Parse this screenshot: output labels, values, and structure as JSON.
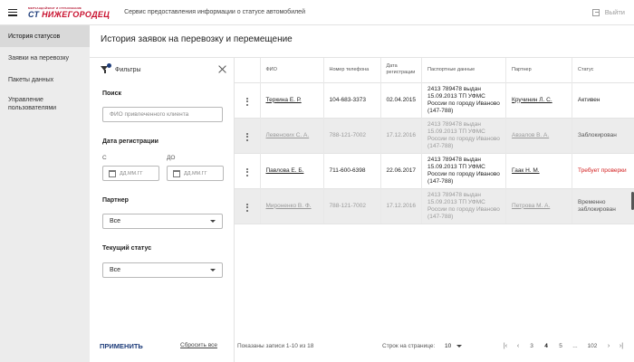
{
  "header": {
    "logo_top": "МЕРЧАНДАЙЗИНГ И СТРАХОВАНИЕ",
    "logo_main_prefix": "СТ",
    "logo_main": "НИЖЕГОРОДЕЦ",
    "subtitle": "Сервис предоставления информации о статусе автомобилей",
    "exit_label": "Выйти"
  },
  "sidebar": {
    "items": [
      {
        "label": "История статусов",
        "active": true
      },
      {
        "label": "Заявки на перевозку",
        "active": false
      },
      {
        "label": "Пакеты данных",
        "active": false
      },
      {
        "label": "Управление пользователями",
        "active": false
      }
    ]
  },
  "page": {
    "title": "История заявок на перевозку и перемещение"
  },
  "filters": {
    "title": "Фильтры",
    "search_label": "Поиск",
    "search_placeholder": "ФИО привлеченного клиента",
    "date_label": "Дата регистрации",
    "from_label": "С",
    "to_label": "ДО",
    "date_placeholder": "ДД.ММ.ГГ",
    "partner_label": "Партнер",
    "partner_value": "Все",
    "status_label": "Текущий статус",
    "status_value": "Все",
    "apply_label": "ПРИМЕНИТЬ",
    "reset_label": "Сбросить все"
  },
  "table": {
    "columns": [
      "ФИО",
      "Номер телефона",
      "Дата регистрации",
      "Паспортные данные",
      "Партнер",
      "Статус"
    ],
    "rows": [
      {
        "name": "Теркина Е. Р.",
        "phone": "104-683-3373",
        "date": "02.04.2015",
        "passport": "2413 789478 выдан 15.09.2013 ТП УФМС России по городу Иваново (147-788)",
        "partner": "Кручинин Л. С.",
        "status": "Активен"
      },
      {
        "name": "Левенских С. А.",
        "phone": "788-121-7002",
        "date": "17.12.2016",
        "passport": "2413 789478 выдан 15.09.2013 ТП УФМС России по городу Иваново (147-788)",
        "partner": "Авзалов В. А.",
        "status": "Заблокирован"
      },
      {
        "name": "Павлова Е. Б.",
        "phone": "711-600-6398",
        "date": "22.06.2017",
        "passport": "2413 789478 выдан 15.09.2013 ТП УФМС России по городу Иваново (147-788)",
        "partner": "Гаак Н. М.",
        "status": "Требует проверки"
      },
      {
        "name": "Мироненко В. Ф.",
        "phone": "788-121-7002",
        "date": "17.12.2016",
        "passport": "2413 789478 выдан 15.09.2013 ТП УФМС России по городу Иваново (147-788)",
        "partner": "Петрова М. А.",
        "status": "Временно заблокирован"
      }
    ]
  },
  "footer": {
    "records_label": "Показаны записи 1-10 из 18",
    "rows_per_page_label": "Строк на странице:",
    "rows_per_page_value": "10",
    "pages": [
      "3",
      "4",
      "5",
      "...",
      "102"
    ],
    "current_page": "4"
  },
  "colors": {
    "brand_red": "#c8102e",
    "brand_blue": "#1d3c7a",
    "status_warning": "#d32020"
  }
}
